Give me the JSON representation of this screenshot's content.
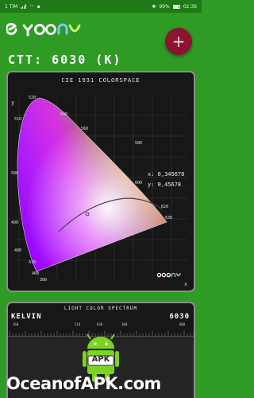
{
  "status_bar": {
    "carrier": "1 TIM",
    "battery": "99%",
    "time": "02:36"
  },
  "app": {
    "logo": "eyconv",
    "add_label": "+",
    "ctt_text": "CTT: 6030 (K)"
  },
  "colorspace": {
    "title": "CIE 1931 COLORSPACE",
    "x_readout": "x: 0,345678",
    "y_readout": "y: 0,45678",
    "axis_x_label": "x",
    "axis_y_label": "y",
    "wavelength_labels": [
      "520",
      "510",
      "540",
      "500",
      "560",
      "490",
      "580",
      "600",
      "620",
      "630",
      "480",
      "470",
      "460",
      "380"
    ]
  },
  "spectrum": {
    "title": "LIGHT COLOR SPECTRUM",
    "kelvin_label": "KELVIN",
    "kelvin_value": "6030",
    "ticks": [
      "360",
      "510",
      "830",
      "300",
      "800"
    ]
  },
  "watermark": {
    "text": "OceanofAPK.com",
    "badge": "APK"
  },
  "colors": {
    "background": "#2f9a24",
    "card": "#171717",
    "border": "#8d8d8d",
    "fab": "#8b1430"
  }
}
